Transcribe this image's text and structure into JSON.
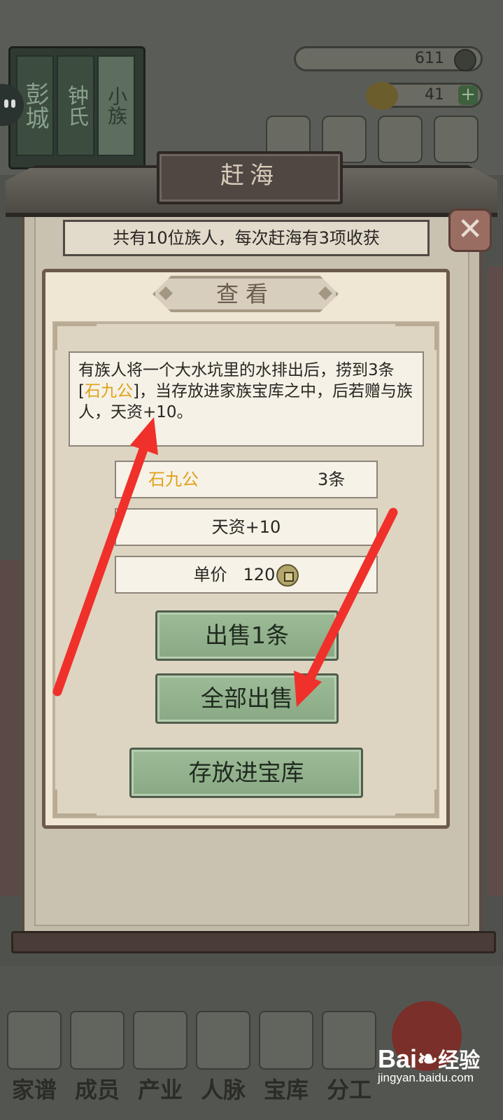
{
  "background": {
    "book_spines": [
      "彭城",
      "钟氏",
      "小族"
    ],
    "copper_coins": "611",
    "gold_ingots": "41",
    "bottom_tabs": [
      "家谱",
      "成员",
      "产业",
      "人脉",
      "宝库",
      "分工"
    ]
  },
  "dialog": {
    "title": "赶海",
    "info_text": "共有10位族人，每次赶海有3项收获",
    "close_icon": "close-x-icon"
  },
  "view_panel": {
    "title": "查看",
    "description": {
      "part1": "有族人将一个大水坑里的水排出后，捞到3条[",
      "item_name": "石九公",
      "part2": "]，当存放进家族宝库之中，后若赠与族人，天资+10。"
    },
    "item_name": "石九公",
    "item_quantity": "3条",
    "effect": "天资+10",
    "price_label": "单价",
    "price_value": "120",
    "price_icon": "copper-coin-icon",
    "buttons": {
      "sell_one": "出售1条",
      "sell_all": "全部出售",
      "store": "存放进宝库"
    }
  },
  "watermark": {
    "brand": "Bai",
    "brand_cn": "经验",
    "site": "jingyan.baidu.com"
  },
  "colors": {
    "highlight_item": "#e0a21a",
    "button_green": "#9dbb97",
    "annotation_arrow": "#f0302a"
  }
}
